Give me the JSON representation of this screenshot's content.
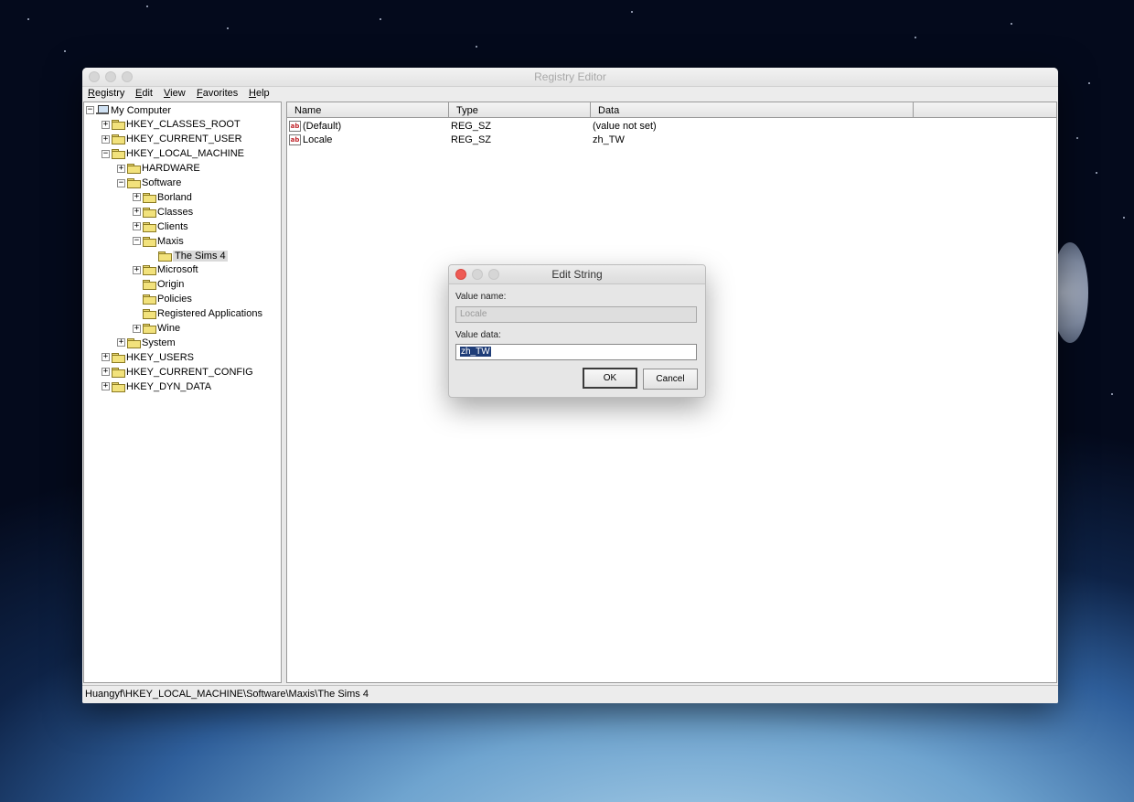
{
  "window": {
    "title": "Registry Editor"
  },
  "menu": [
    {
      "label": "Registry"
    },
    {
      "label": "Edit"
    },
    {
      "label": "View"
    },
    {
      "label": "Favorites"
    },
    {
      "label": "Help"
    }
  ],
  "tree": [
    {
      "label": "My Computer",
      "icon": "computer-icon",
      "expander": "−",
      "level": 0
    },
    {
      "label": "HKEY_CLASSES_ROOT",
      "icon": "folder-icon",
      "expander": "+",
      "level": 1
    },
    {
      "label": "HKEY_CURRENT_USER",
      "icon": "folder-icon",
      "expander": "+",
      "level": 1
    },
    {
      "label": "HKEY_LOCAL_MACHINE",
      "icon": "folder-icon",
      "expander": "−",
      "level": 1
    },
    {
      "label": "HARDWARE",
      "icon": "folder-icon",
      "expander": "+",
      "level": 2
    },
    {
      "label": "Software",
      "icon": "folder-icon",
      "expander": "−",
      "level": 2
    },
    {
      "label": "Borland",
      "icon": "folder-icon",
      "expander": "+",
      "level": 3
    },
    {
      "label": "Classes",
      "icon": "folder-icon",
      "expander": "+",
      "level": 3
    },
    {
      "label": "Clients",
      "icon": "folder-icon",
      "expander": "+",
      "level": 3
    },
    {
      "label": "Maxis",
      "icon": "folder-icon",
      "expander": "−",
      "level": 3
    },
    {
      "label": "The Sims 4",
      "icon": "folder-open-icon",
      "expander": "",
      "level": 4,
      "selected": true
    },
    {
      "label": "Microsoft",
      "icon": "folder-icon",
      "expander": "+",
      "level": 3
    },
    {
      "label": "Origin",
      "icon": "folder-icon",
      "expander": "",
      "level": 3
    },
    {
      "label": "Policies",
      "icon": "folder-icon",
      "expander": "",
      "level": 3
    },
    {
      "label": "Registered Applications",
      "icon": "folder-icon",
      "expander": "",
      "level": 3
    },
    {
      "label": "Wine",
      "icon": "folder-icon",
      "expander": "+",
      "level": 3
    },
    {
      "label": "System",
      "icon": "folder-icon",
      "expander": "+",
      "level": 2
    },
    {
      "label": "HKEY_USERS",
      "icon": "folder-icon",
      "expander": "+",
      "level": 1
    },
    {
      "label": "HKEY_CURRENT_CONFIG",
      "icon": "folder-icon",
      "expander": "+",
      "level": 1
    },
    {
      "label": "HKEY_DYN_DATA",
      "icon": "folder-icon",
      "expander": "+",
      "level": 1
    }
  ],
  "list": {
    "columns": [
      "Name",
      "Type",
      "Data"
    ],
    "rows": [
      {
        "name": "(Default)",
        "type": "REG_SZ",
        "data": "(value not set)",
        "icon": "string-value-icon"
      },
      {
        "name": "Locale",
        "type": "REG_SZ",
        "data": "zh_TW",
        "icon": "string-value-icon"
      }
    ]
  },
  "status": {
    "path": "Huangyf\\HKEY_LOCAL_MACHINE\\Software\\Maxis\\The Sims 4"
  },
  "dialog": {
    "title": "Edit String",
    "value_name_label": "Value name:",
    "value_name": "Locale",
    "value_data_label": "Value data:",
    "value_data": "zh_TW",
    "ok_label": "OK",
    "cancel_label": "Cancel",
    "close_color": "#ee5b55"
  }
}
